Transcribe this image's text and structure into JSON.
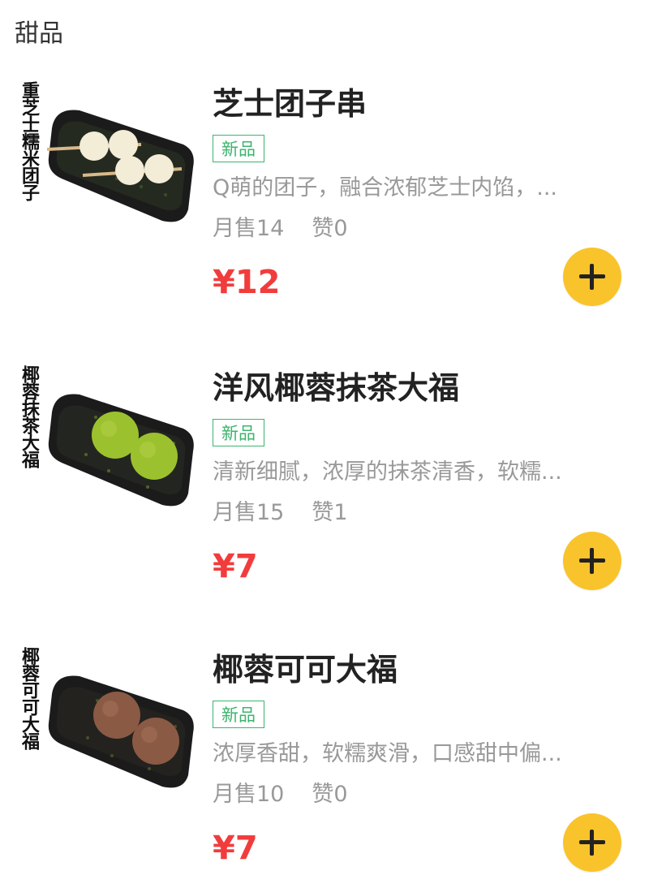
{
  "category": {
    "title": "甜品"
  },
  "items": [
    {
      "image_label": "重芝士糯米团子",
      "name": "芝士团子串",
      "tag": "新品",
      "desc": "Q萌的团子，融合浓郁芝士内馅，...",
      "sold": "月售14",
      "likes": "赞0",
      "price": "¥12",
      "ball_color": "#f3ecd6"
    },
    {
      "image_label": "椰蓉抹茶大福",
      "name": "洋风椰蓉抹茶大福",
      "tag": "新品",
      "desc": "清新细腻，浓厚的抹茶清香，软糯...",
      "sold": "月售15",
      "likes": "赞1",
      "price": "¥7",
      "ball_color": "#9cc12e"
    },
    {
      "image_label": "椰蓉可可大福",
      "name": "椰蓉可可大福",
      "tag": "新品",
      "desc": "浓厚香甜，软糯爽滑，口感甜中偏...",
      "sold": "月售10",
      "likes": "赞0",
      "price": "¥7",
      "ball_color": "#8a5a45"
    }
  ],
  "colors": {
    "price": "#f23c3c",
    "tag": "#3cb46e",
    "add_button": "#f9c32b"
  },
  "icons": {
    "add": "plus-icon"
  }
}
